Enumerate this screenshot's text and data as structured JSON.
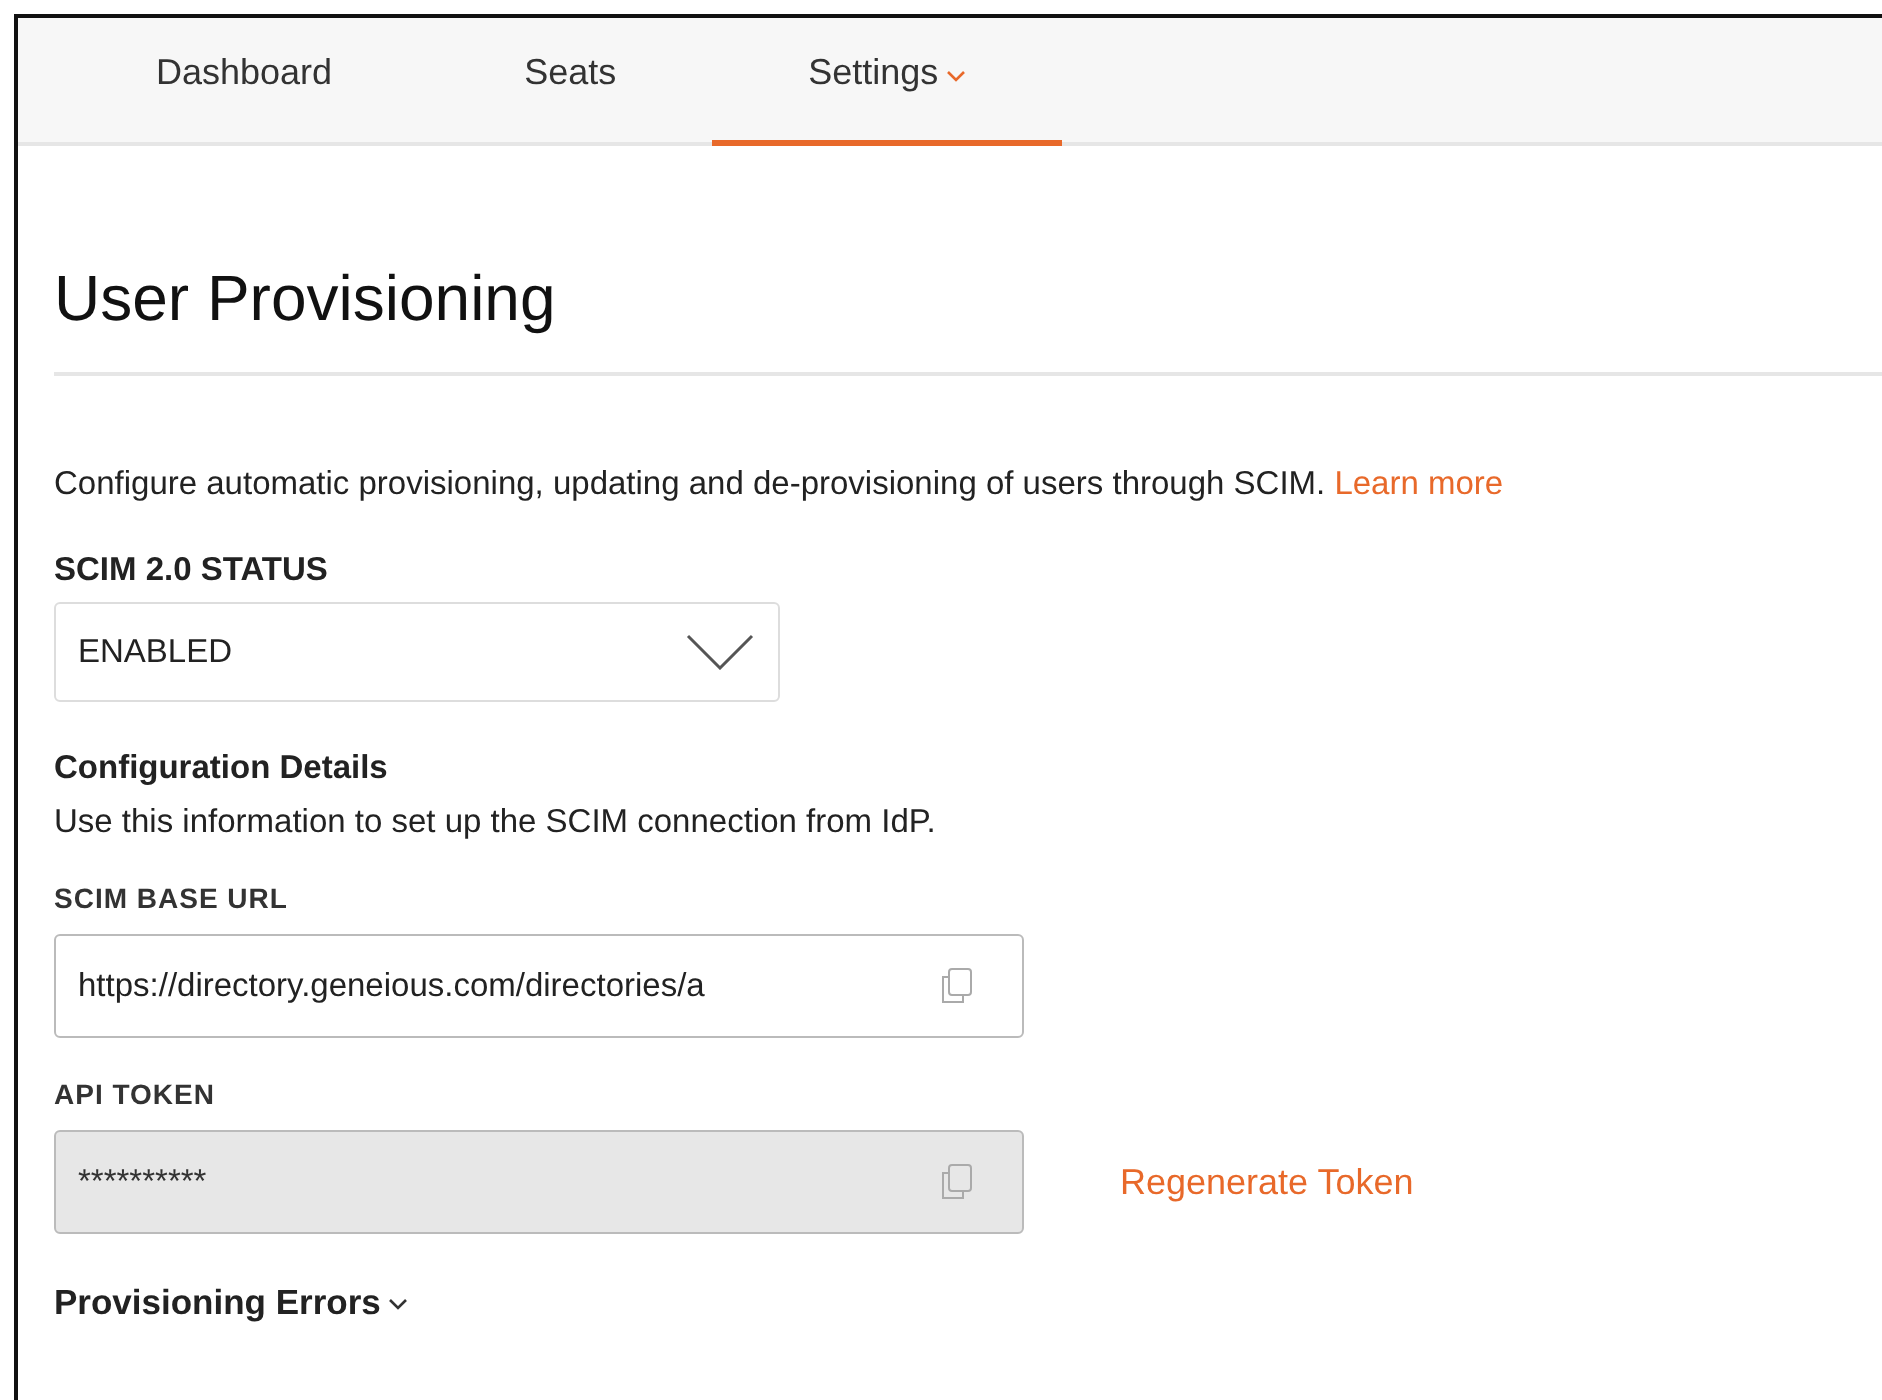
{
  "tabs": [
    {
      "label": "Dashboard",
      "selected": false,
      "has_menu": false
    },
    {
      "label": "Seats",
      "selected": false,
      "has_menu": false
    },
    {
      "label": "Settings",
      "selected": true,
      "has_menu": true
    }
  ],
  "heading": "User Provisioning",
  "description": "Configure automatic provisioning, updating and de-provisioning of users through SCIM.",
  "learn_more": "Learn more",
  "scim_status": {
    "label": "SCIM 2.0 STATUS",
    "value": "ENABLED"
  },
  "config": {
    "title": "Configuration Details",
    "text": "Use this information to set up the SCIM connection from IdP."
  },
  "fields": [
    {
      "label": "SCIM BASE URL",
      "value": "https://directory.geneious.com/directories/a",
      "disabled": false
    },
    {
      "label": "API TOKEN",
      "value": "**********",
      "disabled": true,
      "action": "Regenerate Token"
    }
  ],
  "errors_section": {
    "label": "Provisioning Errors",
    "expanded": false
  }
}
